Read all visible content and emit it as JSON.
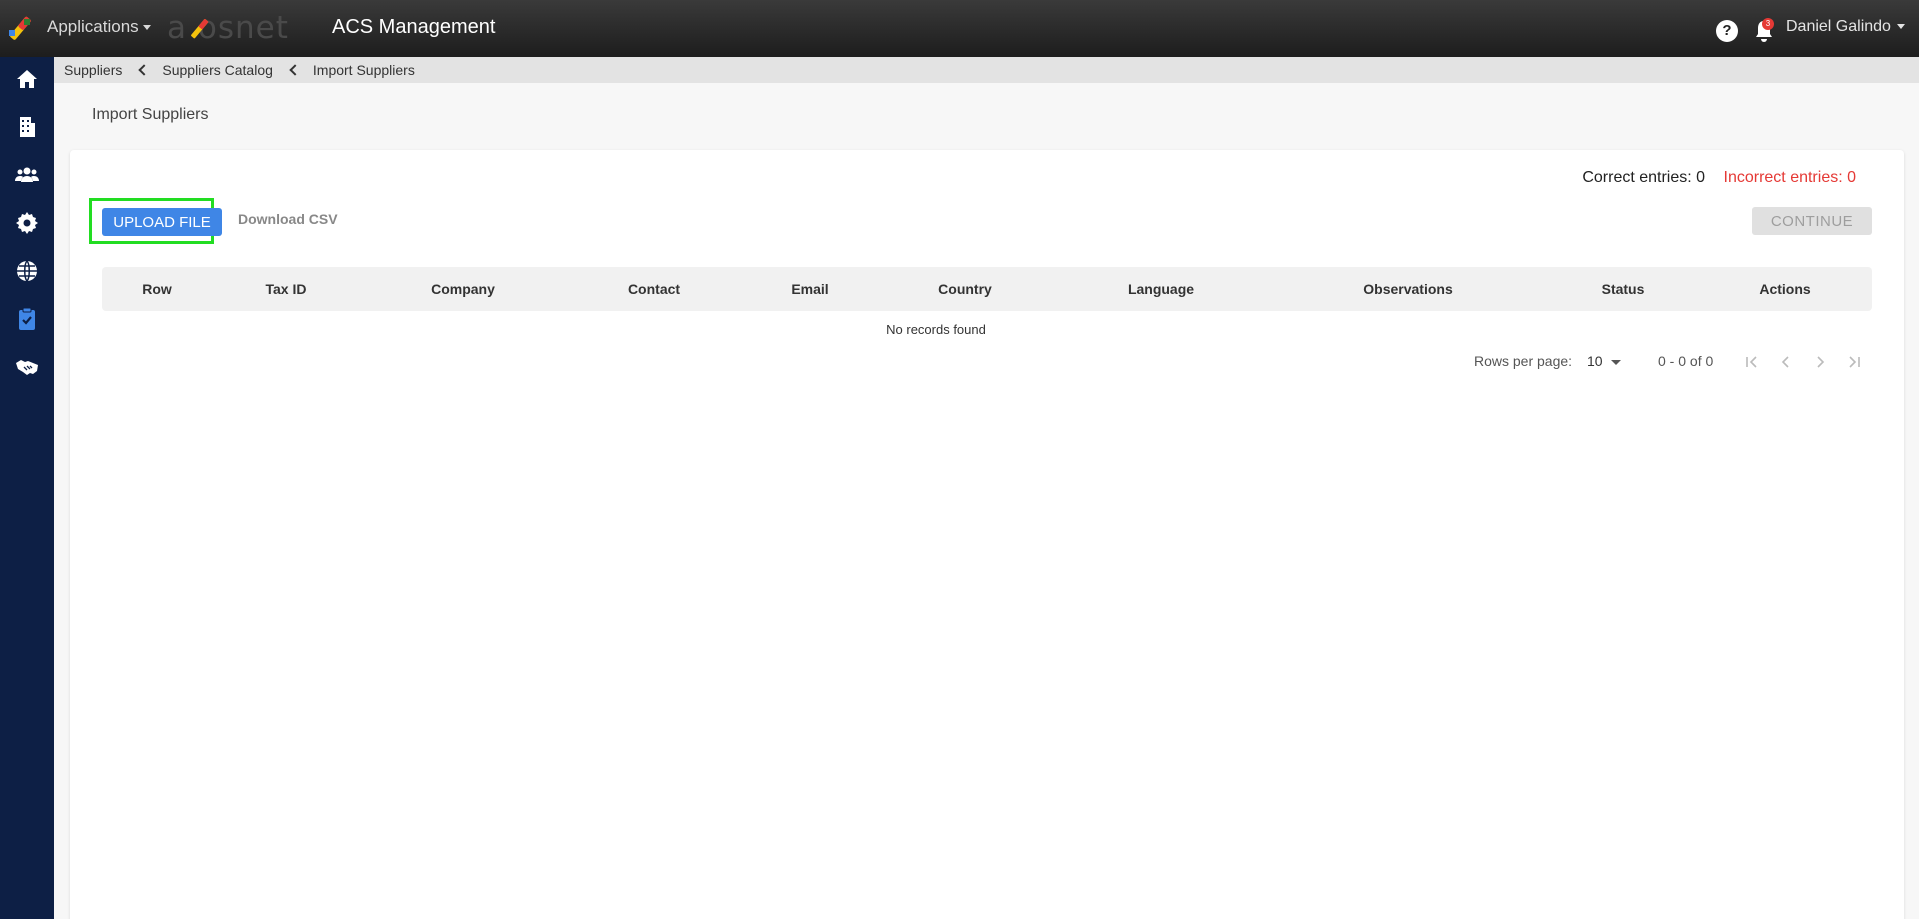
{
  "header": {
    "apps_label": "Applications",
    "brand": "a osnet",
    "title": "ACS Management",
    "help_glyph": "?",
    "notifications_count": "3",
    "user_name": "Daniel Galindo"
  },
  "sidebar": {
    "items": [
      {
        "icon": "home-icon"
      },
      {
        "icon": "building-icon"
      },
      {
        "icon": "users-icon"
      },
      {
        "icon": "gear-icon"
      },
      {
        "icon": "globe-icon"
      },
      {
        "icon": "clipboard-check-icon",
        "active": true
      },
      {
        "icon": "handshake-icon"
      }
    ]
  },
  "breadcrumb": [
    "Suppliers",
    "Suppliers Catalog",
    "Import Suppliers"
  ],
  "page": {
    "title": "Import Suppliers",
    "correct_entries": "Correct entries: 0",
    "incorrect_entries": "Incorrect entries: 0",
    "upload_label": "UPLOAD FILE",
    "download_label": "Download CSV",
    "continue_label": "CONTINUE"
  },
  "table": {
    "columns": [
      "Row",
      "Tax ID",
      "Company",
      "Contact",
      "Email",
      "Country",
      "Language",
      "Observations",
      "Status",
      "Actions"
    ],
    "empty_text": "No records found"
  },
  "pagination": {
    "rows_per_page_label": "Rows per page:",
    "rows_per_page": "10",
    "range": "0 - 0 of 0"
  },
  "colors": {
    "primary": "#3f86e6",
    "sidebar": "#0d1f45",
    "error": "#e53935",
    "highlight": "#22dd22"
  }
}
